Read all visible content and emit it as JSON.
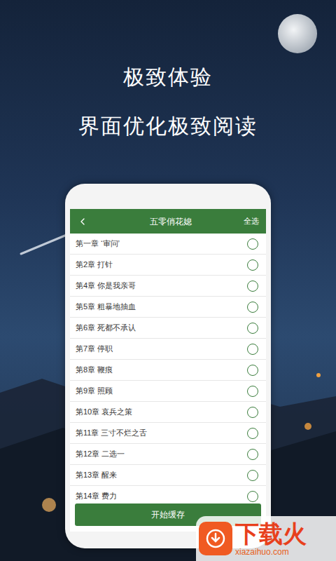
{
  "promo": {
    "headlines": [
      "极致体验",
      "界面优化极致阅读"
    ]
  },
  "app": {
    "header": {
      "title": "五零俏花媳",
      "action": "全选"
    },
    "chapters": [
      {
        "title": "第一章 ‘审问’",
        "selected": false
      },
      {
        "title": "第2章 打针",
        "selected": false
      },
      {
        "title": "第4章 你是我亲哥",
        "selected": false
      },
      {
        "title": "第5章 粗暴地抽血",
        "selected": false
      },
      {
        "title": "第6章 死都不承认",
        "selected": false
      },
      {
        "title": "第7章 停职",
        "selected": false
      },
      {
        "title": "第8章 鞭痕",
        "selected": false
      },
      {
        "title": "第9章 照顾",
        "selected": false
      },
      {
        "title": "第10章 哀兵之策",
        "selected": false
      },
      {
        "title": "第11章 三寸不烂之舌",
        "selected": false
      },
      {
        "title": "第12章 二选一",
        "selected": false
      },
      {
        "title": "第13章 醒来",
        "selected": false
      },
      {
        "title": "第14章 费力",
        "selected": false
      }
    ],
    "button": "开始缓存"
  },
  "watermark": {
    "brand": "下载火",
    "domain": "xiazaihuo.com"
  }
}
